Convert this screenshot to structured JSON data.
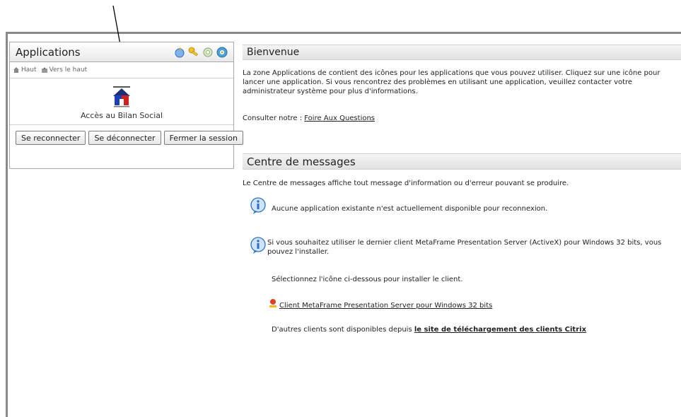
{
  "applications_panel": {
    "title": "Applications",
    "nav": {
      "top": "Haut",
      "up": "Vers le haut"
    },
    "app": {
      "label": "Accès au Bilan Social"
    },
    "buttons": {
      "reconnect": "Se reconnecter",
      "disconnect": "Se déconnecter",
      "logout": "Fermer la session"
    },
    "header_icons": [
      "refresh-icon",
      "key-icon",
      "settings-icon",
      "help-icon"
    ]
  },
  "welcome": {
    "title": "Bienvenue",
    "text": "La zone Applications de contient des icônes pour les applications que vous pouvez utiliser. Cliquez sur une icône pour lancer une application. Si vous rencontrez des problèmes en utilisant une application, veuillez contacter votre administrateur système pour plus d'informations.",
    "faq_prefix": "Consulter notre : ",
    "faq_link": "Foire Aux Questions"
  },
  "messages": {
    "title": "Centre de messages",
    "intro": "Le Centre de messages affiche tout message d'information ou d'erreur pouvant se produire.",
    "msg1": "Aucune application existante n'est actuellement disponible pour reconnexion.",
    "msg2": "Si vous souhaitez utiliser le dernier client MetaFrame Presentation Server (ActiveX) pour Windows 32 bits, vous pouvez l'installer.",
    "select_text": "Sélectionnez l'icône ci-dessous pour installer le client.",
    "client_link": "Client MetaFrame Presentation Server pour Windows 32 bits",
    "others_prefix": "D'autres clients sont disponibles depuis ",
    "others_link": "le site de téléchargement des clients Citrix"
  },
  "colors": {
    "frame": "#8a8a8a",
    "section_bar": "#e2e2e2",
    "info_blue": "#2a6fc9"
  }
}
